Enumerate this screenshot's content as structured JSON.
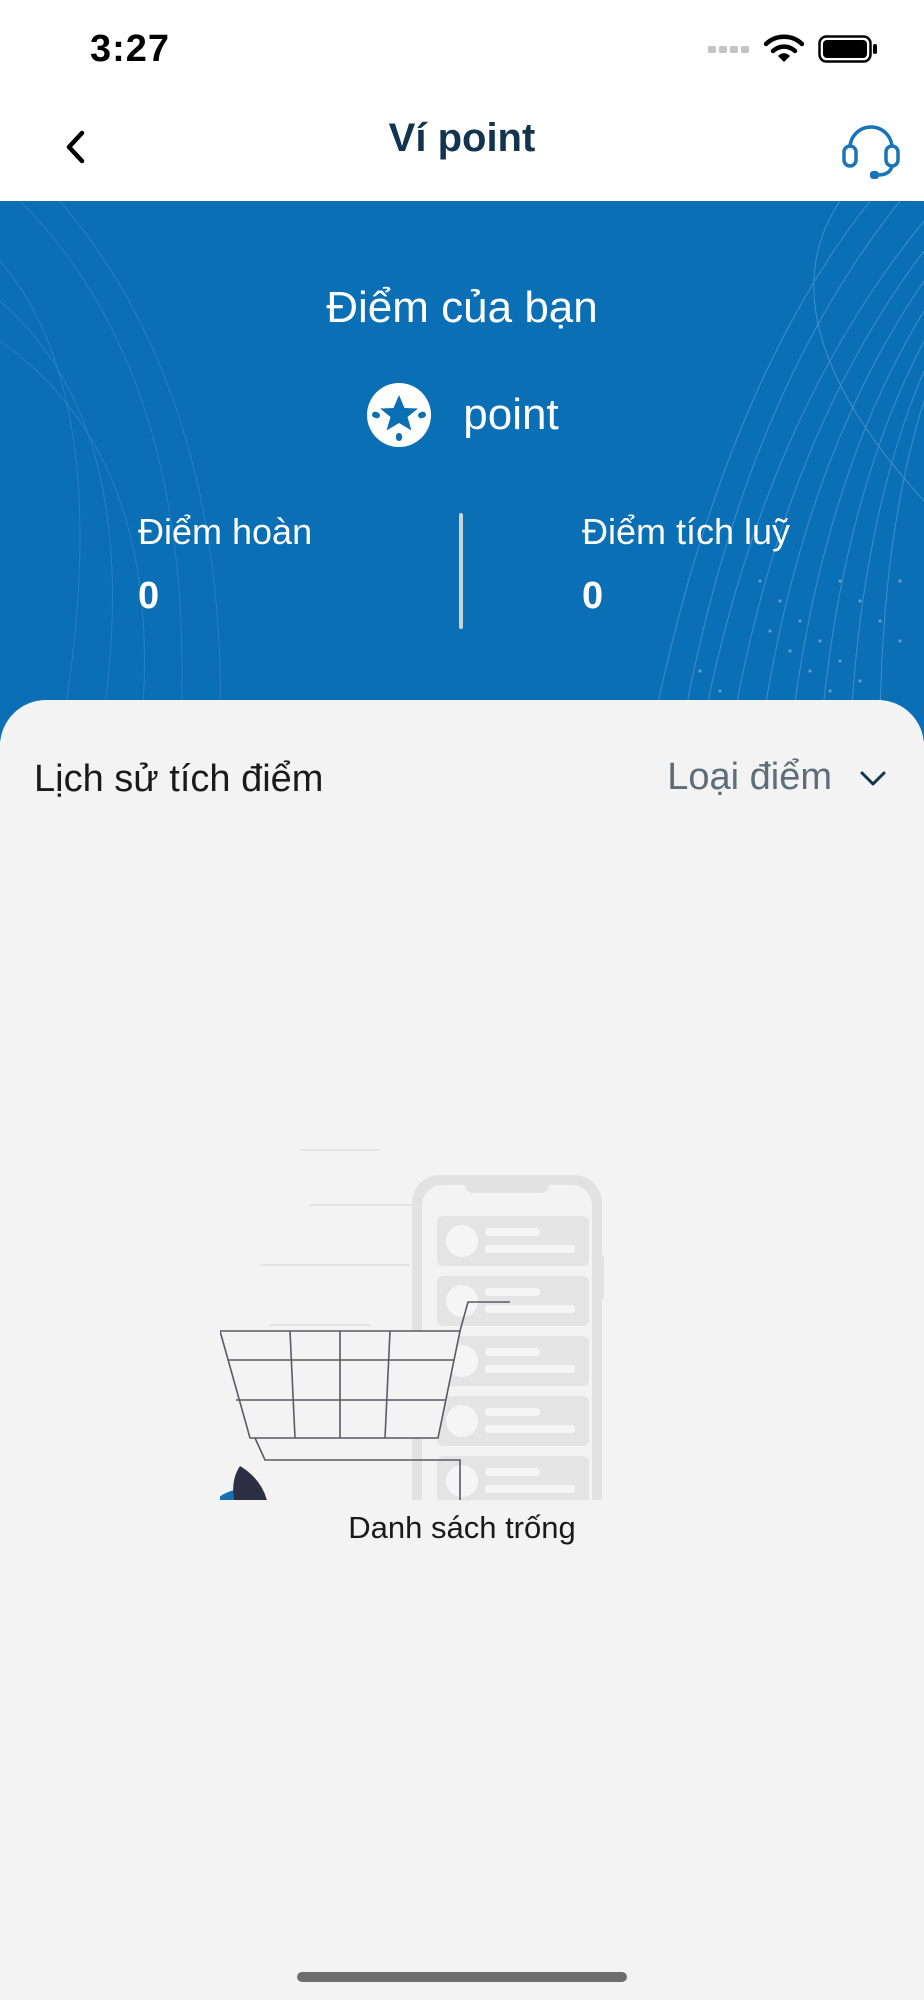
{
  "status_bar": {
    "time": "3:27"
  },
  "nav": {
    "title": "Ví point",
    "back_icon": "chevron-left-icon",
    "support_icon": "headset-icon"
  },
  "wallet": {
    "heading": "Điểm của bạn",
    "brand_name": "point",
    "refund_points_label": "Điểm hoàn",
    "refund_points_value": "0",
    "accumulated_points_label": "Điểm tích luỹ",
    "accumulated_points_value": "0"
  },
  "history": {
    "title": "Lịch sử tích điểm",
    "filter_label": "Loại điểm",
    "empty_text": "Danh sách trống"
  },
  "colors": {
    "primary_blue": "#0a6fb4",
    "title_navy": "#12344f",
    "background": "#f3f3f3"
  }
}
